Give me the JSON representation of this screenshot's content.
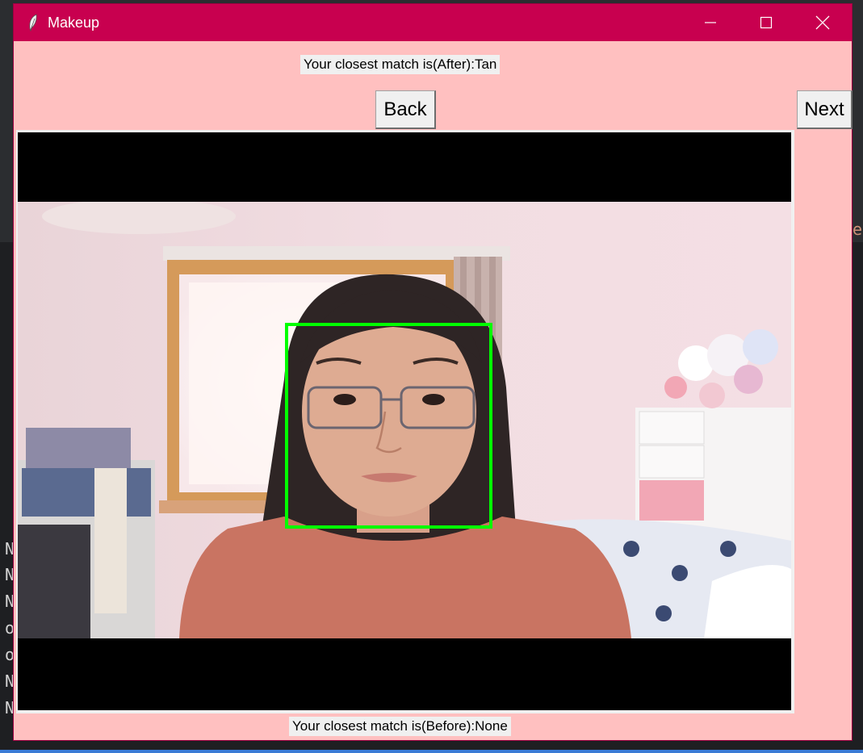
{
  "window": {
    "title": "Makeup",
    "minimize_label": "Minimize",
    "maximize_label": "Maximize",
    "close_label": "Close",
    "titlebar_color": "#c8004f",
    "background_color": "#ffc0c0"
  },
  "labels": {
    "after": "Your closest match is(After):Tan",
    "before": "Your closest match is(Before):None"
  },
  "buttons": {
    "back": "Back",
    "next": "Next"
  },
  "camera": {
    "face_box_color": "#00ff00"
  },
  "background_editor": {
    "side_text": "e",
    "code_lines": [
      "N",
      "N",
      "N",
      "ol",
      "ol",
      "N",
      "N"
    ]
  }
}
